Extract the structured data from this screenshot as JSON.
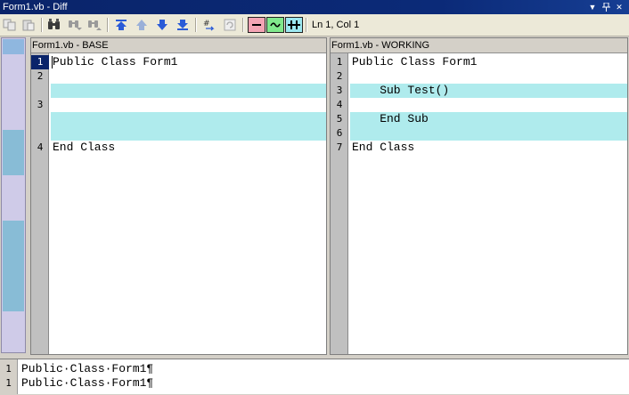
{
  "window": {
    "title": "Form1.vb - Diff",
    "controls": {
      "menu": "▼",
      "pin": "📌",
      "close": "✕"
    }
  },
  "toolbar": {
    "status": "Ln 1, Col 1",
    "buttons": [
      "copy-icon",
      "paste-icon",
      "find-icon",
      "find-next-icon",
      "find-previous-icon",
      "first-difference-icon",
      "previous-difference-icon",
      "next-difference-icon",
      "last-difference-icon",
      "goto-line-icon",
      "refresh-icon",
      "show-deleted-icon",
      "show-changed-icon",
      "show-inserted-icon"
    ],
    "colors": {
      "deleted": "#f4a4b4",
      "changed": "#80e88c",
      "inserted": "#9ce7f0"
    }
  },
  "base": {
    "title": "Form1.vb - BASE",
    "lines": [
      {
        "num": "1",
        "text": "Public Class Form1",
        "changed": false
      },
      {
        "num": "2",
        "text": "",
        "changed": false
      },
      {
        "num": "",
        "text": "",
        "changed": true
      },
      {
        "num": "3",
        "text": "",
        "changed": false
      },
      {
        "num": "",
        "text": "",
        "changed": true
      },
      {
        "num": "",
        "text": "",
        "changed": true
      },
      {
        "num": "4",
        "text": "End Class",
        "changed": false
      }
    ]
  },
  "working": {
    "title": "Form1.vb - WORKING",
    "lines": [
      {
        "num": "1",
        "text": "Public Class Form1",
        "changed": false
      },
      {
        "num": "2",
        "text": "",
        "changed": false
      },
      {
        "num": "3",
        "text": "    Sub Test()",
        "changed": true
      },
      {
        "num": "4",
        "text": "",
        "changed": false
      },
      {
        "num": "5",
        "text": "    End Sub",
        "changed": true
      },
      {
        "num": "6",
        "text": "",
        "changed": true
      },
      {
        "num": "7",
        "text": "End Class",
        "changed": false
      }
    ]
  },
  "compare": {
    "lines": [
      {
        "num": "1",
        "text": "Public·Class·Form1¶"
      },
      {
        "num": "1",
        "text": "Public·Class·Form1¶"
      }
    ]
  },
  "colors": {
    "changed_line": "#afebed",
    "overview_mark": "#88bcd6",
    "title_bar": "#0a246a"
  }
}
